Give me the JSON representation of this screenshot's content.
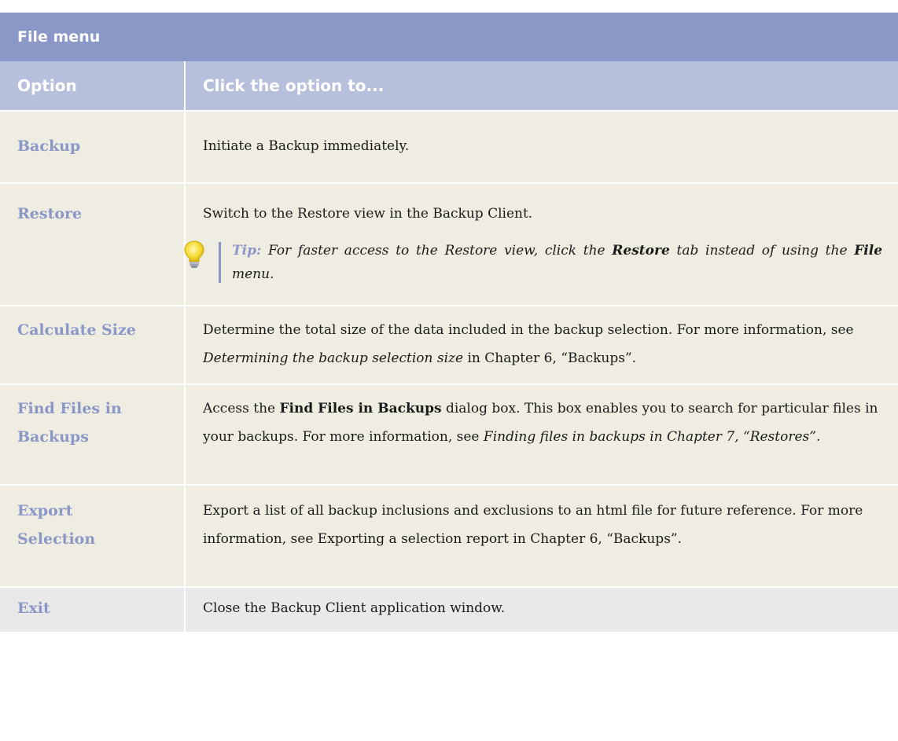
{
  "title": "File menu",
  "headers": {
    "option": "Option",
    "action": "Click the option to..."
  },
  "rows": {
    "backup": {
      "option": "Backup",
      "text": "Initiate a Backup immediately."
    },
    "restore": {
      "option": "Restore",
      "text": "Switch to the Restore view in the Backup Client.",
      "tip_label": "Tip:",
      "tip_part1": "For faster access to the Restore view, click the",
      "tip_bold1": "Restore",
      "tip_part2": "tab instead of using the",
      "tip_bold2": "File",
      "tip_part3": "menu."
    },
    "calculate": {
      "option": "Calculate Size",
      "text1": "Determine the total size of the data included in the backup selection. For more information, see",
      "italic": "Determining the backup selection size",
      "text2": "in Chapter 6, “Backups”."
    },
    "find": {
      "option_line1": "Find Files in",
      "option_line2": "Backups",
      "text1": "Access the",
      "bold": "Find Files in Backups",
      "text2": "dialog box. This box enables you to search for particular files in your backups. For more information, see",
      "italic": "Finding files in backups in Chapter 7, “Restores”."
    },
    "export": {
      "option_line1": "Export",
      "option_line2": "Selection",
      "text": "Export a list of all backup inclusions and exclusions to an html file for future reference. For more information, see Exporting a selection report in Chapter 6, “Backups”."
    },
    "exit": {
      "option": "Exit",
      "text": "Close the Backup Client application window."
    }
  },
  "icons": {
    "tip": "lightbulb-icon"
  },
  "colors": {
    "title_bg": "#8a97c7",
    "header_bg": "#b6c0dd",
    "row_bg": "#efece2",
    "exit_row_bg": "#e9e9e9",
    "accent": "#8a97c7"
  }
}
